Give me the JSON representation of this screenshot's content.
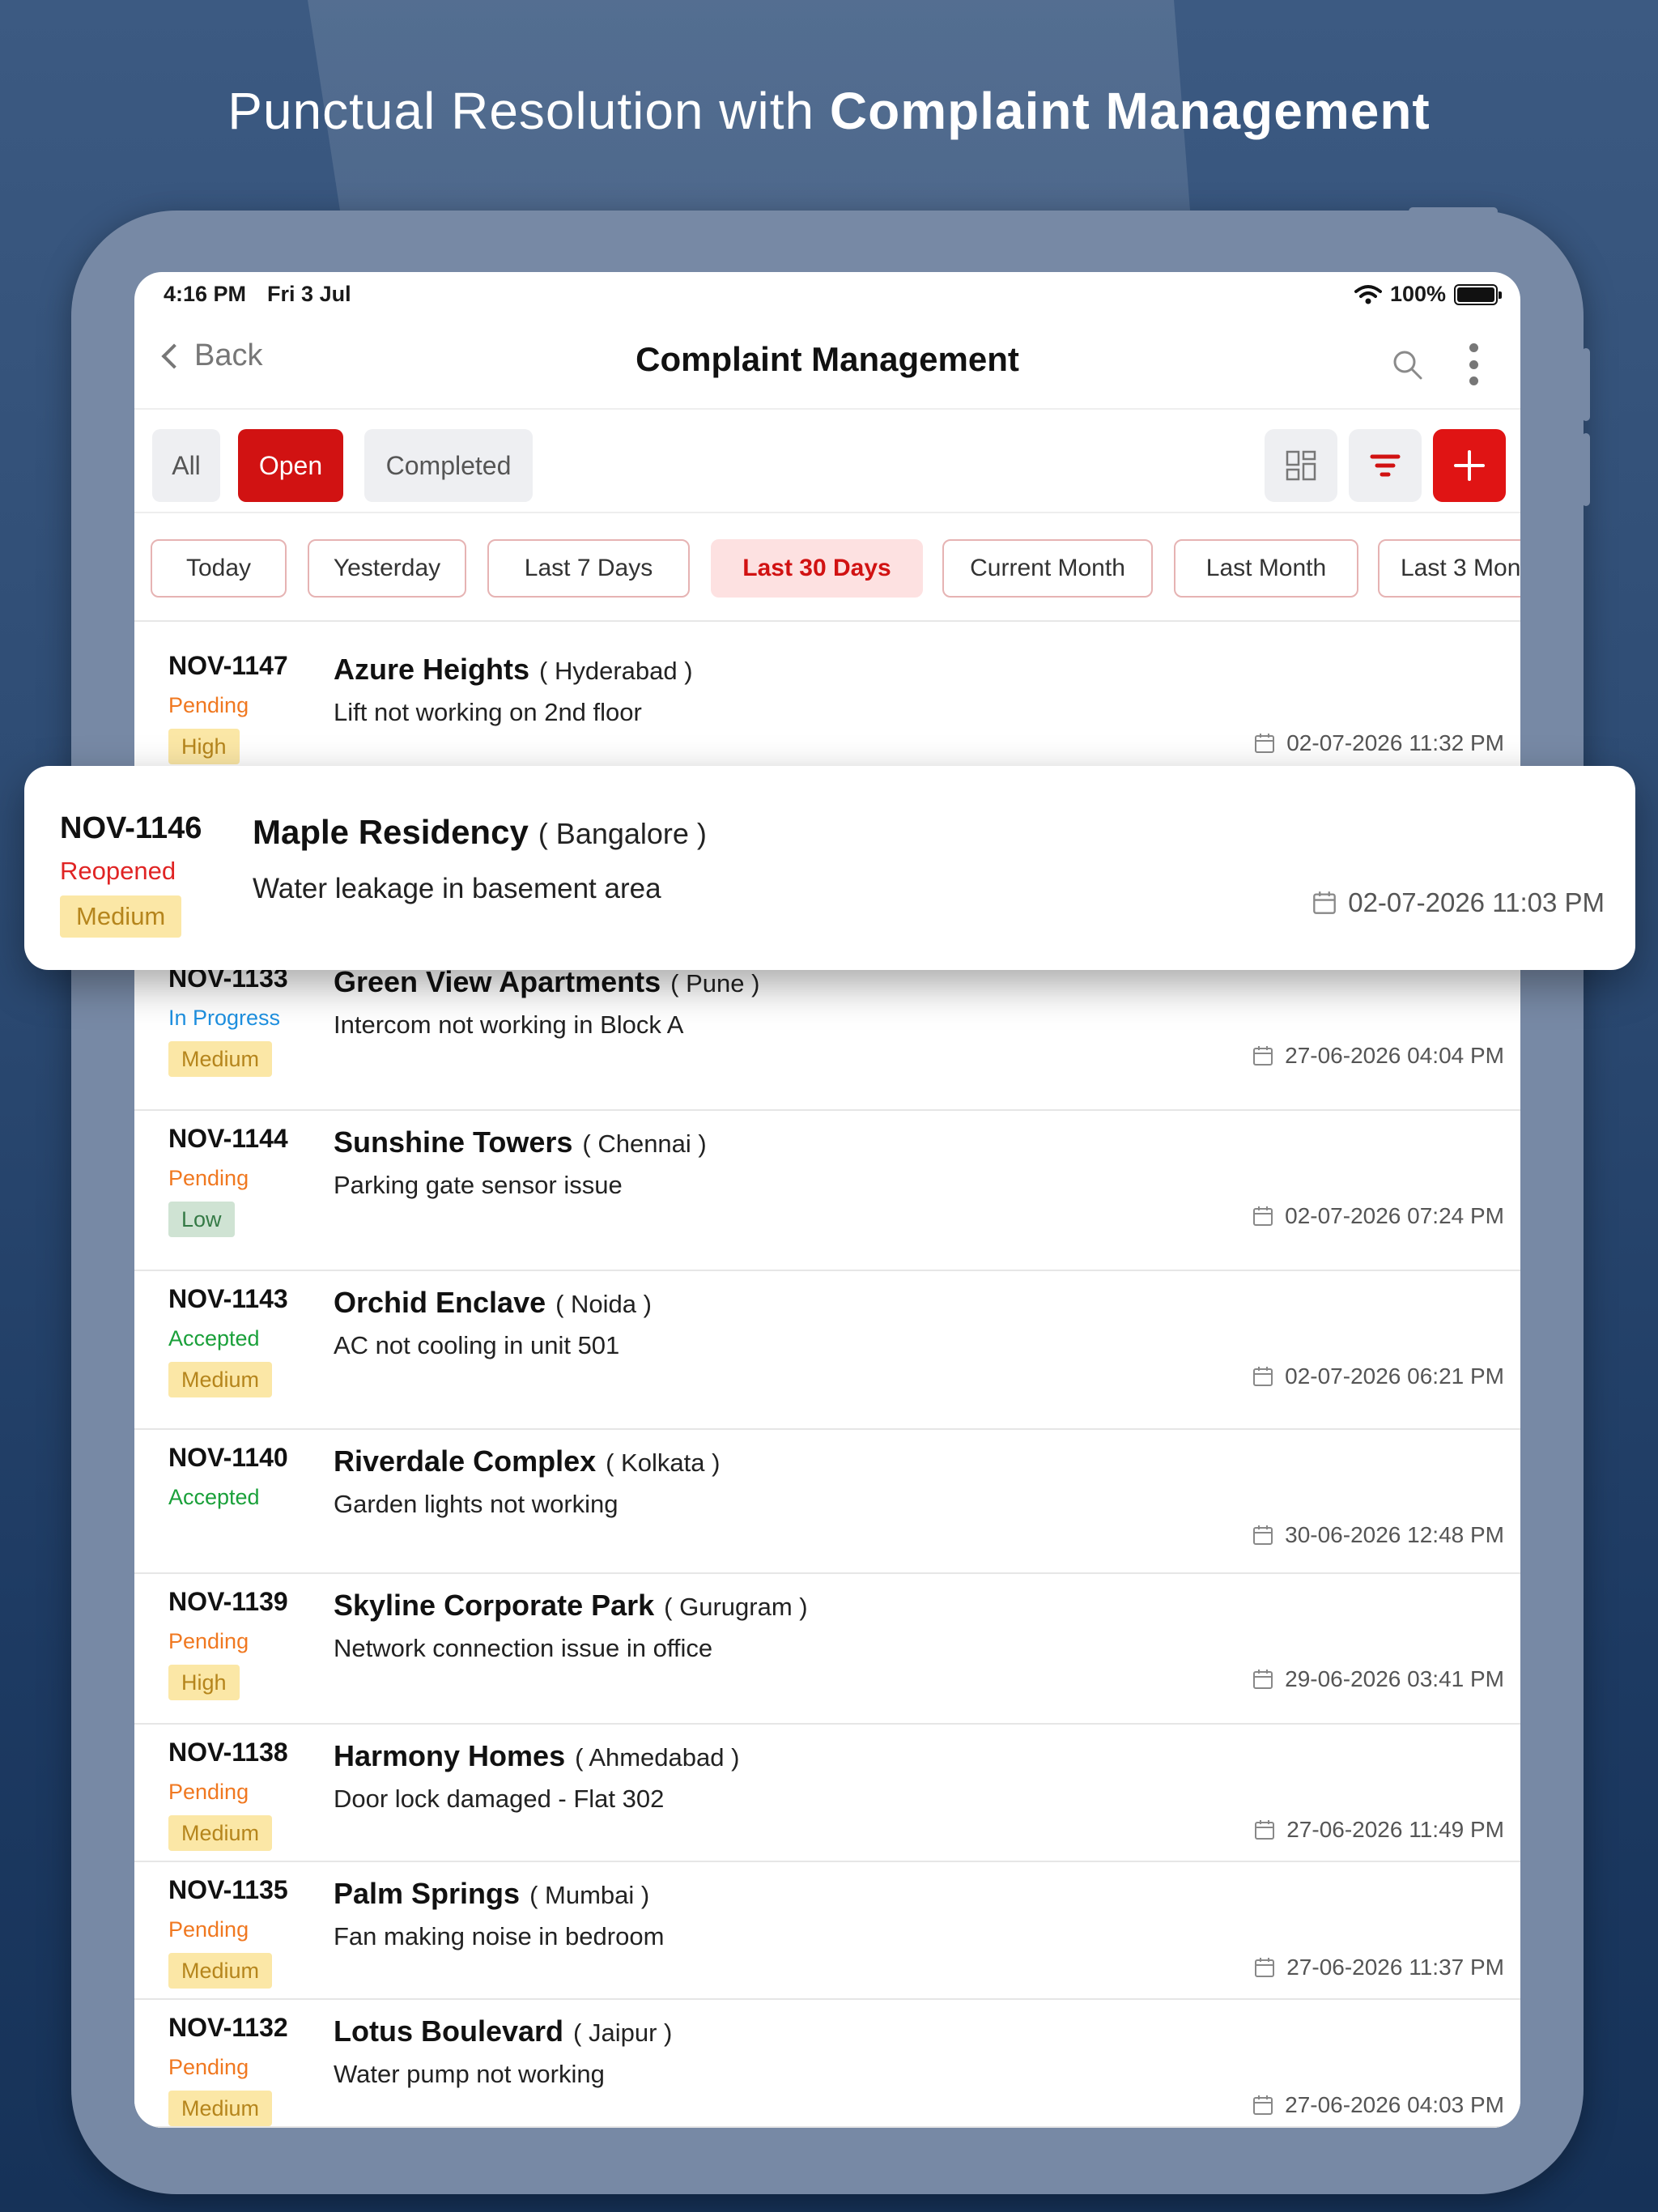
{
  "headline": {
    "regular": "Punctual Resolution with ",
    "bold": "Complaint Management"
  },
  "status_bar": {
    "time": "4:16 PM",
    "date": "Fri 3 Jul",
    "battery": "100%"
  },
  "nav": {
    "back_label": "Back",
    "title": "Complaint Management"
  },
  "tabs": [
    "All",
    "Open",
    "Completed"
  ],
  "active_tab": "Open",
  "date_filters": [
    "Today",
    "Yesterday",
    "Last 7 Days",
    "Last 30 Days",
    "Current Month",
    "Last Month",
    "Last 3 Mont"
  ],
  "active_filter": "Last 30 Days",
  "colors": {
    "accent": "#d11212",
    "pending": "#f07820",
    "reopened": "#e02424",
    "in_progress": "#1e90e0",
    "accepted": "#1aa03a"
  },
  "complaints": [
    {
      "id": "NOV-1147",
      "status": "Pending",
      "priority": "High",
      "name": "Azure Heights",
      "city": "( Hyderabad )",
      "desc": "Lift not working on 2nd floor",
      "date": "02-07-2026 11:32 PM"
    },
    {
      "id": "NOV-1146",
      "status": "Reopened",
      "priority": "Medium",
      "name": "Maple Residency",
      "city": "( Bangalore )",
      "desc": "Water leakage in basement area",
      "date": "02-07-2026 11:03 PM"
    },
    {
      "id": "NOV-1133",
      "status": "In Progress",
      "priority": "Medium",
      "name": "Green View Apartments",
      "city": "( Pune )",
      "desc": "Intercom not working in Block A",
      "date": "27-06-2026 04:04 PM"
    },
    {
      "id": "NOV-1144",
      "status": "Pending",
      "priority": "Low",
      "name": "Sunshine Towers",
      "city": "( Chennai )",
      "desc": "Parking gate sensor issue",
      "date": "02-07-2026 07:24 PM"
    },
    {
      "id": "NOV-1143",
      "status": "Accepted",
      "priority": "Medium",
      "name": "Orchid Enclave",
      "city": "( Noida )",
      "desc": "AC not cooling in unit 501",
      "date": "02-07-2026 06:21 PM"
    },
    {
      "id": "NOV-1140",
      "status": "Accepted",
      "priority": "",
      "name": "Riverdale Complex",
      "city": "( Kolkata )",
      "desc": "Garden lights not working",
      "date": "30-06-2026 12:48 PM"
    },
    {
      "id": "NOV-1139",
      "status": "Pending",
      "priority": "High",
      "name": "Skyline Corporate Park",
      "city": "( Gurugram )",
      "desc": "Network connection issue in office",
      "date": "29-06-2026 03:41 PM"
    },
    {
      "id": "NOV-1138",
      "status": "Pending",
      "priority": "Medium",
      "name": "Harmony Homes",
      "city": "( Ahmedabad )",
      "desc": "Door lock damaged - Flat 302",
      "date": "27-06-2026 11:49 PM"
    },
    {
      "id": "NOV-1135",
      "status": "Pending",
      "priority": "Medium",
      "name": "Palm Springs",
      "city": "( Mumbai )",
      "desc": "Fan making noise in bedroom",
      "date": "27-06-2026 11:37 PM"
    },
    {
      "id": "NOV-1132",
      "status": "Pending",
      "priority": "Medium",
      "name": "Lotus Boulevard",
      "city": "( Jaipur )",
      "desc": "Water pump not working",
      "date": "27-06-2026 04:03 PM"
    }
  ]
}
